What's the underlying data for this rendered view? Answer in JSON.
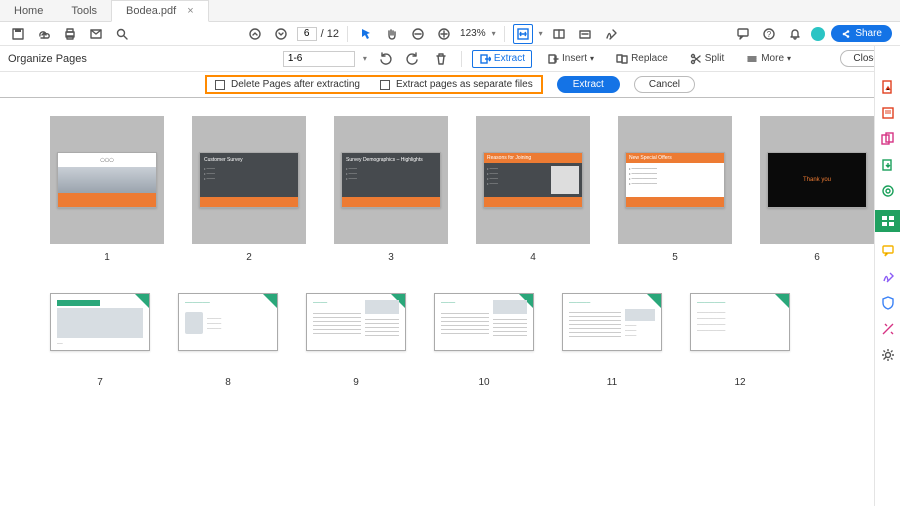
{
  "tabs": {
    "home": "Home",
    "tools": "Tools",
    "file": "Bodea.pdf"
  },
  "toolbar": {
    "page_current": "6",
    "page_total": "/  12",
    "zoom": "123%",
    "share": "Share"
  },
  "tools_row": {
    "title": "Organize Pages",
    "range": "1-6",
    "extract": "Extract",
    "insert": "Insert",
    "replace": "Replace",
    "split": "Split",
    "more": "More",
    "close": "Close"
  },
  "extract_bar": {
    "opt1": "Delete Pages after extracting",
    "opt2": "Extract pages as separate files",
    "extract": "Extract",
    "cancel": "Cancel"
  },
  "thumbs_row1": [
    {
      "num": "1",
      "variant": "cover"
    },
    {
      "num": "2",
      "variant": "dark",
      "title": "Customer Survey"
    },
    {
      "num": "3",
      "variant": "dark",
      "title": "Survey Demographics – Highlights"
    },
    {
      "num": "4",
      "variant": "reasons",
      "title": "Reasons for Joining"
    },
    {
      "num": "5",
      "variant": "offers",
      "title": "New Special Offers"
    },
    {
      "num": "6",
      "variant": "thanks",
      "title": "Thank you"
    }
  ],
  "thumbs_row2": [
    {
      "num": "7"
    },
    {
      "num": "8"
    },
    {
      "num": "9"
    },
    {
      "num": "10"
    },
    {
      "num": "11"
    },
    {
      "num": "12"
    }
  ]
}
